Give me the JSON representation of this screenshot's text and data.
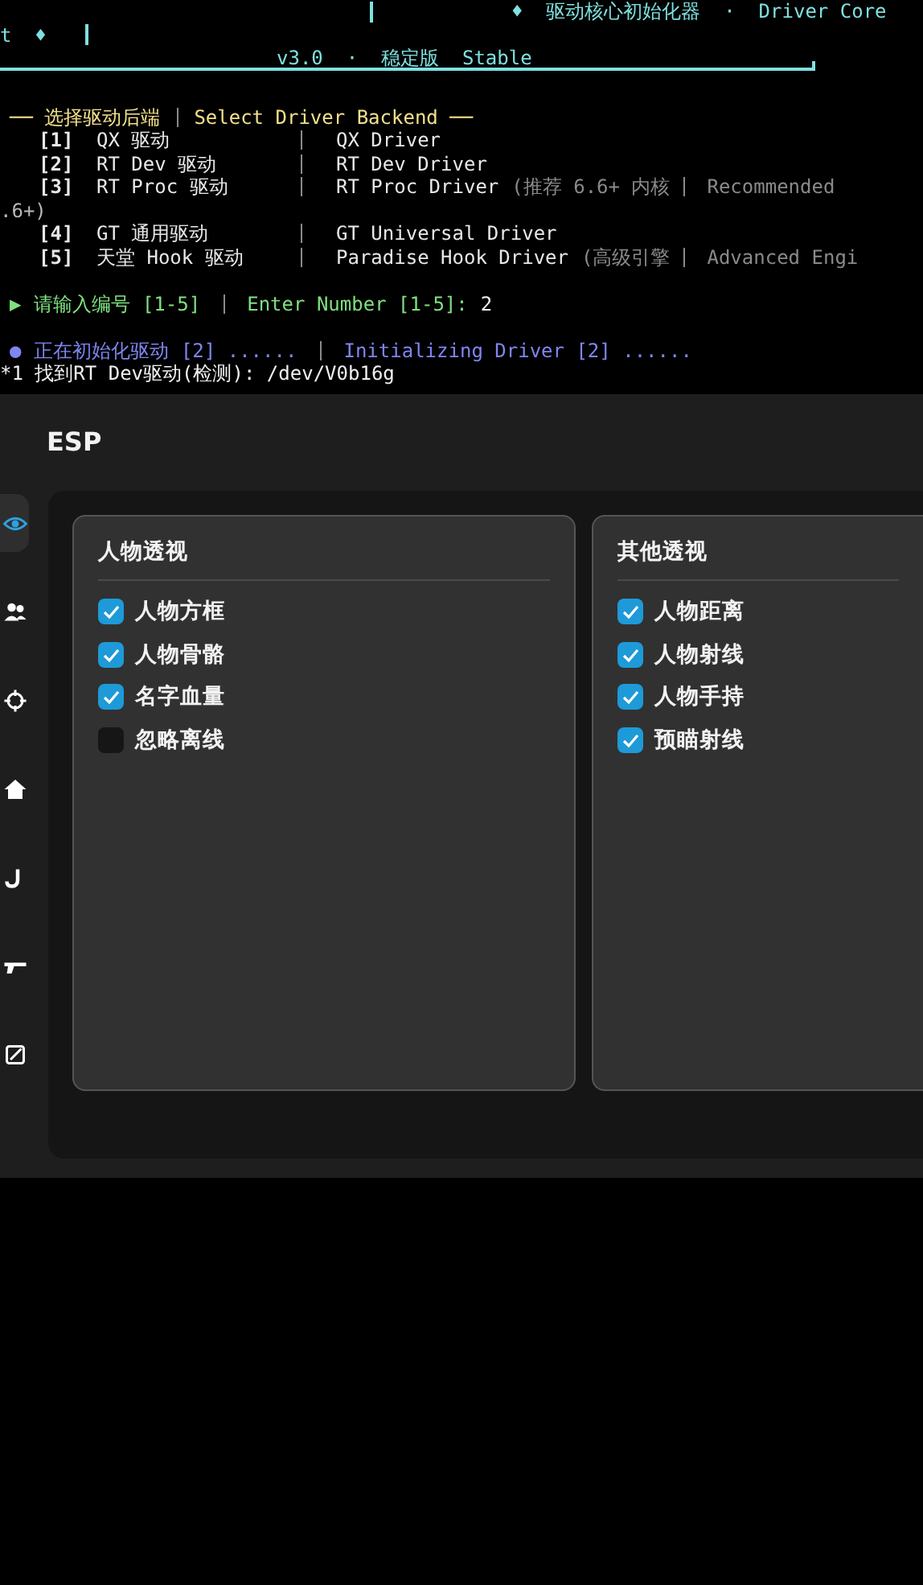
{
  "terminal": {
    "banner": {
      "title": "♦  驱动核心初始化器  ·  Driver Core",
      "title_tail": "t  ♦",
      "version": "v3.0  ·  稳定版  Stable"
    },
    "menu_heading": {
      "cn": "── 选择驱动后端",
      "en": "Select Driver Backend ──"
    },
    "drivers": [
      {
        "number": "[1]",
        "name": "QX 驱动",
        "driver": "QX Driver"
      },
      {
        "number": "[2]",
        "name": "RT Dev 驱动",
        "driver": "RT Dev Driver"
      },
      {
        "number": "[3]",
        "name": "RT Proc 驱动",
        "driver": "RT Proc Driver",
        "note": "(推荐 6.6+ 内核",
        "note_en": "Recommended",
        "wrap": ".6+)"
      },
      {
        "number": "[4]",
        "name": "GT 通用驱动",
        "driver": "GT Universal Driver"
      },
      {
        "number": "[5]",
        "name": "天堂 Hook 驱动",
        "driver": "Paradise Hook Driver",
        "note": "(高级引擎",
        "note_en": "Advanced Engi"
      }
    ],
    "prompt": {
      "marker": "▶",
      "cn": "请输入编号 [1-5]",
      "en": "Enter Number [1-5]:",
      "value": "2"
    },
    "status": {
      "marker": "●",
      "cn": "正在初始化驱动 [2] ......",
      "en": "Initializing Driver [2] ......"
    },
    "log": "*1 找到RT Dev驱动(检测): /dev/V0b16g"
  },
  "app": {
    "title": "ESP",
    "sidebar": {
      "items": [
        {
          "selected": true
        },
        {
          "selected": false
        },
        {
          "selected": false
        },
        {
          "selected": false
        },
        {
          "selected": false
        },
        {
          "selected": false
        },
        {
          "selected": false
        }
      ]
    },
    "cards": [
      {
        "title": "人物透视",
        "options": [
          {
            "label": "人物方框",
            "checked": true
          },
          {
            "label": "人物骨骼",
            "checked": true
          },
          {
            "label": "名字血量",
            "checked": true
          },
          {
            "label": "忽略离线",
            "checked": false
          }
        ]
      },
      {
        "title": "其他透视",
        "options": [
          {
            "label": "人物距离",
            "checked": true
          },
          {
            "label": "人物射线",
            "checked": true
          },
          {
            "label": "人物手持",
            "checked": true
          },
          {
            "label": "预瞄射线",
            "checked": true
          }
        ]
      }
    ]
  }
}
